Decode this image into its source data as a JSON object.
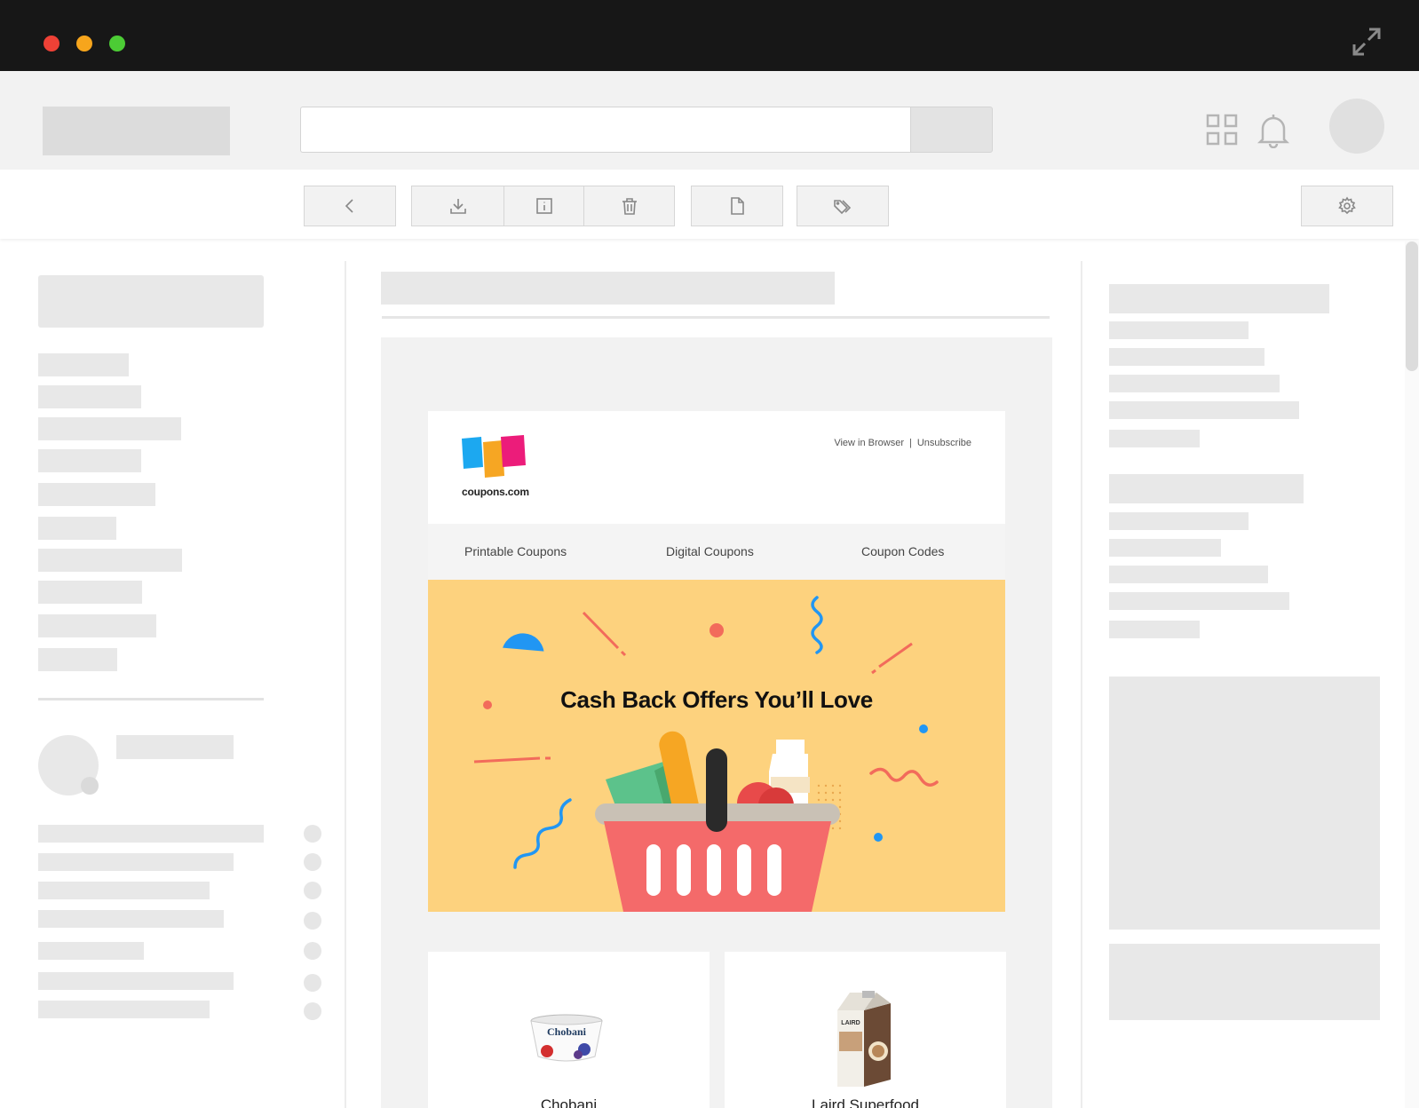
{
  "window": {
    "controls": [
      "close",
      "minimize",
      "maximize"
    ],
    "expand_icon": "expand-icon"
  },
  "header": {
    "apps_icon": "grid-icon",
    "notification_icon": "bell-icon"
  },
  "toolbar": {
    "buttons": [
      "back-icon",
      "download-icon",
      "info-icon",
      "trash-icon",
      "file-icon",
      "tag-icon",
      "gear-icon"
    ]
  },
  "email": {
    "brand": "coupons.com",
    "header_links": {
      "view_in_browser": "View in Browser",
      "separator": "|",
      "unsubscribe": "Unsubscribe"
    },
    "nav": [
      {
        "label": "Printable Coupons"
      },
      {
        "label": "Digital Coupons"
      },
      {
        "label": "Coupon Codes"
      }
    ],
    "hero": {
      "title": "Cash Back Offers You’ll Love",
      "background": "#fdd27e"
    },
    "products": [
      {
        "name": "Chobani",
        "image_label": "Chobani"
      },
      {
        "name": "Laird Superfood",
        "image_label": "LAIRD"
      }
    ]
  },
  "colors": {
    "titlebar": "#171717",
    "close": "#ef4136",
    "minimize": "#f7a51c",
    "maximize": "#4ccc35",
    "basket": "#f46a6a"
  }
}
